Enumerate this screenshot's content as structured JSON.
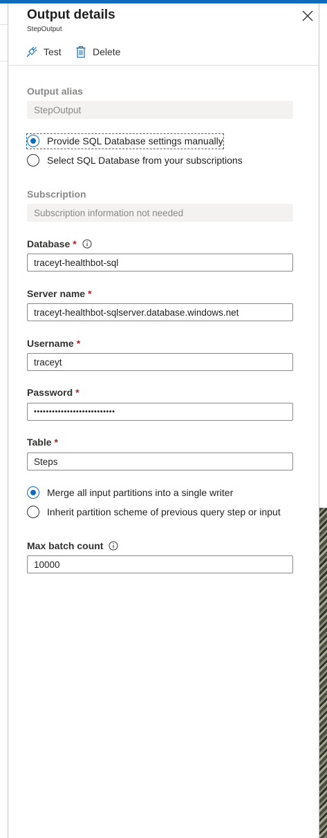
{
  "header": {
    "title": "Output details",
    "subtitle": "StepOutput"
  },
  "commands": {
    "test": "Test",
    "delete": "Delete"
  },
  "output_alias": {
    "label": "Output alias",
    "value": "StepOutput"
  },
  "db_mode": {
    "option_manual": "Provide SQL Database settings manually",
    "option_subscription": "Select SQL Database from your subscriptions",
    "selected": "option_manual"
  },
  "subscription": {
    "label": "Subscription",
    "value": "Subscription information not needed"
  },
  "database": {
    "label": "Database",
    "required": "*",
    "value": "traceyt-healthbot-sql"
  },
  "server": {
    "label": "Server name",
    "required": "*",
    "value": "traceyt-healthbot-sqlserver.database.windows.net"
  },
  "username": {
    "label": "Username",
    "required": "*",
    "value": "traceyt"
  },
  "password": {
    "label": "Password",
    "required": "*",
    "value": "•••••••••••••••••••••••••••"
  },
  "table": {
    "label": "Table",
    "required": "*",
    "value": "Steps"
  },
  "partition": {
    "option_merge": "Merge all input partitions into a single writer",
    "option_inherit": "Inherit partition scheme of previous query step or input",
    "selected": "option_merge"
  },
  "max_batch": {
    "label": "Max batch count",
    "value": "10000"
  },
  "icons": {
    "close": "close-icon",
    "test": "plug-icon",
    "delete": "trash-icon",
    "info": "info-icon"
  },
  "colors": {
    "accent": "#0f6cbd",
    "required": "#a4262c"
  }
}
